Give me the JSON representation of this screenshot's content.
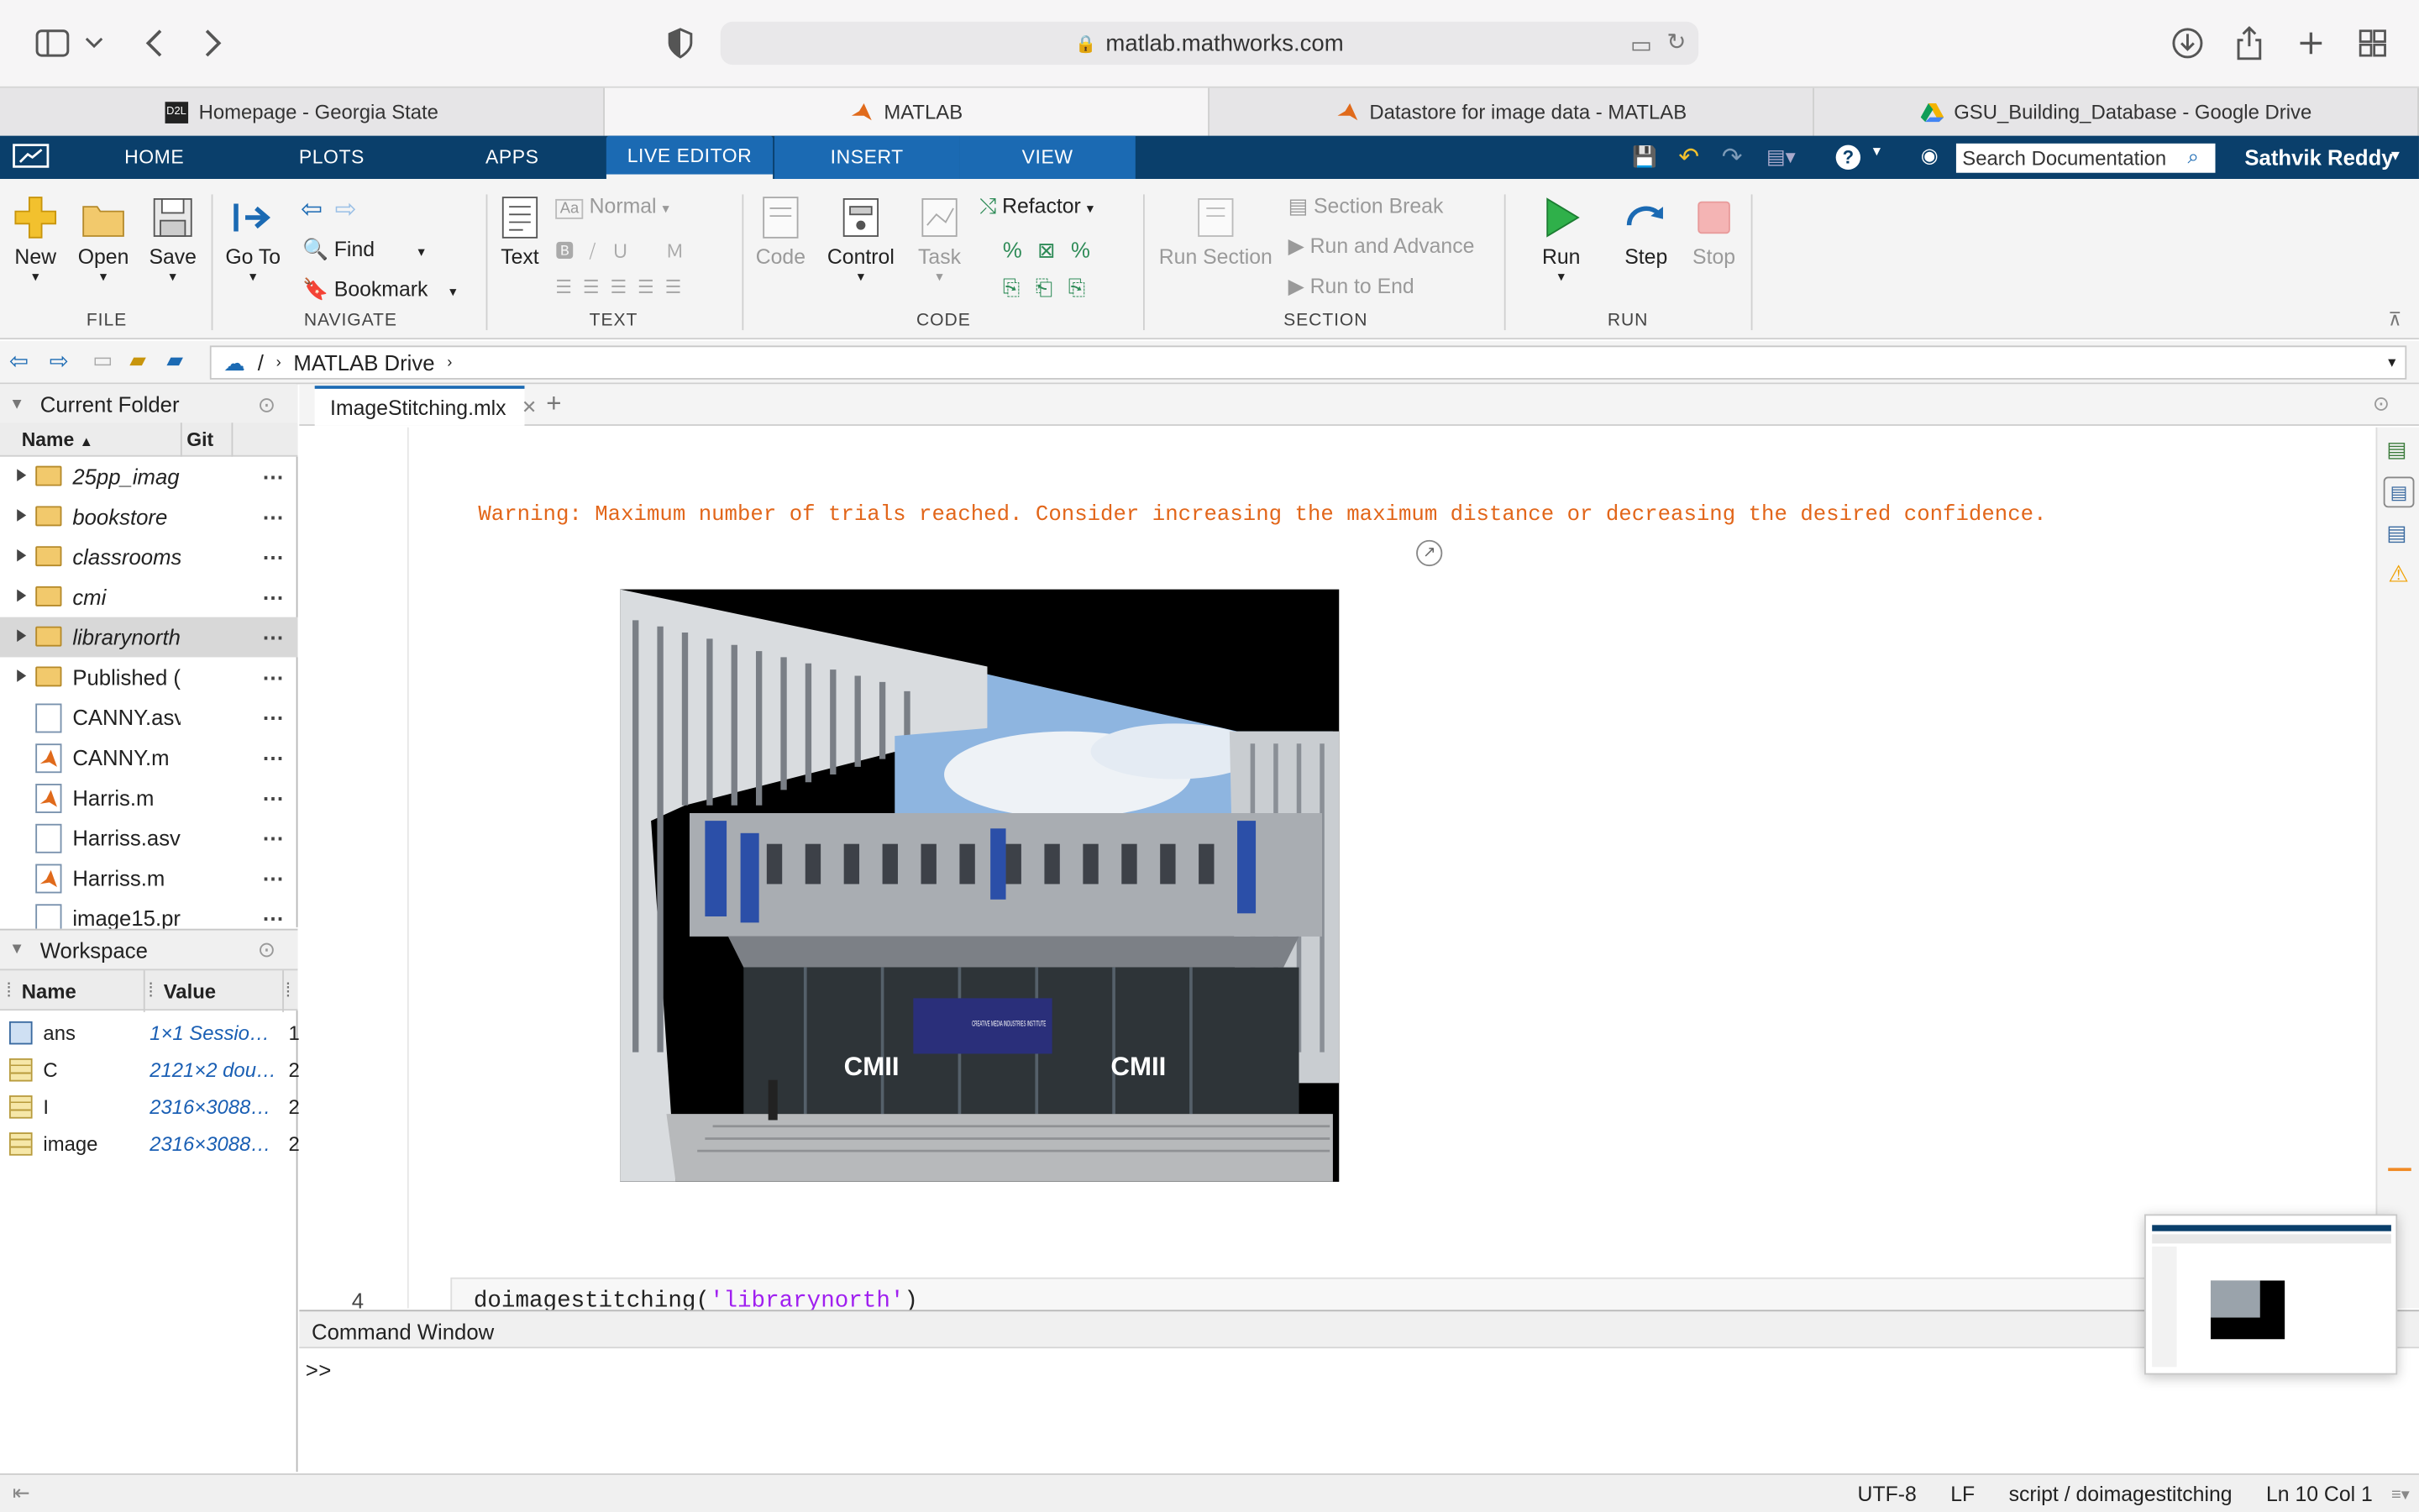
{
  "browser": {
    "url": "matlab.mathworks.com",
    "tabs": [
      {
        "label": "Homepage - Georgia State"
      },
      {
        "label": "MATLAB"
      },
      {
        "label": "Datastore for image data - MATLAB"
      },
      {
        "label": "GSU_Building_Database - Google Drive"
      }
    ]
  },
  "matlab": {
    "tabs": [
      "HOME",
      "PLOTS",
      "APPS",
      "LIVE EDITOR",
      "INSERT",
      "VIEW"
    ],
    "search_placeholder": "Search Documentation",
    "user": "Sathvik Reddy",
    "ribbon": {
      "file": {
        "label": "FILE",
        "new": "New",
        "open": "Open",
        "save": "Save"
      },
      "navigate": {
        "label": "NAVIGATE",
        "goto": "Go To",
        "find": "Find",
        "bookmark": "Bookmark"
      },
      "text": {
        "label": "TEXT",
        "text": "Text",
        "style": "Normal"
      },
      "code": {
        "label": "CODE",
        "code": "Code",
        "control": "Control",
        "task": "Task",
        "refactor": "Refactor"
      },
      "section": {
        "label": "SECTION",
        "run_section": "Run Section",
        "section_break": "Section Break",
        "run_advance": "Run and Advance",
        "run_end": "Run to End"
      },
      "run": {
        "label": "RUN",
        "run": "Run",
        "step": "Step",
        "stop": "Stop"
      }
    },
    "path": {
      "root": "/",
      "folder": "MATLAB Drive"
    },
    "current_folder": {
      "title": "Current Folder",
      "col_name": "Name",
      "col_git": "Git",
      "items": [
        {
          "name": "25pp_imag",
          "type": "folder"
        },
        {
          "name": "bookstore",
          "type": "folder"
        },
        {
          "name": "classrooms",
          "type": "folder"
        },
        {
          "name": "cmi",
          "type": "folder"
        },
        {
          "name": "librarynorth",
          "type": "folder"
        },
        {
          "name": "Published (",
          "type": "folder"
        },
        {
          "name": "CANNY.asv",
          "type": "file"
        },
        {
          "name": "CANNY.m",
          "type": "mfile"
        },
        {
          "name": "Harris.m",
          "type": "mfile"
        },
        {
          "name": "Harriss.asv",
          "type": "file"
        },
        {
          "name": "Harriss.m",
          "type": "mfile"
        },
        {
          "name": "image15.pr",
          "type": "file"
        }
      ]
    },
    "workspace": {
      "title": "Workspace",
      "col_name": "Name",
      "col_value": "Value",
      "vars": [
        {
          "name": "ans",
          "value": "1×1 Sessio…",
          "extra": "1"
        },
        {
          "name": "C",
          "value": "2121×2 dou…",
          "extra": "2"
        },
        {
          "name": "I",
          "value": "2316×3088…",
          "extra": "2"
        },
        {
          "name": "image",
          "value": "2316×3088…",
          "extra": "2"
        }
      ]
    },
    "editor": {
      "tab": "ImageStitching.mlx",
      "warning": "Warning: Maximum number of trials reached. Consider increasing the maximum distance or decreasing the desired confidence.",
      "line_number": "4",
      "code_fn": "doimagestitching(",
      "code_arg": "'librarynorth'",
      "code_end": ")",
      "photo_text": {
        "sign_left": "CMII",
        "sign_right": "CMII",
        "screen": "CREATIVE MEDIA INDUSTRIES INSTITUTE"
      }
    },
    "command": {
      "title": "Command Window",
      "prompt": ">>"
    },
    "status": {
      "encoding": "UTF-8",
      "eol": "LF",
      "script": "script / doimagestitching",
      "pos": "Ln  10  Col  1"
    }
  }
}
